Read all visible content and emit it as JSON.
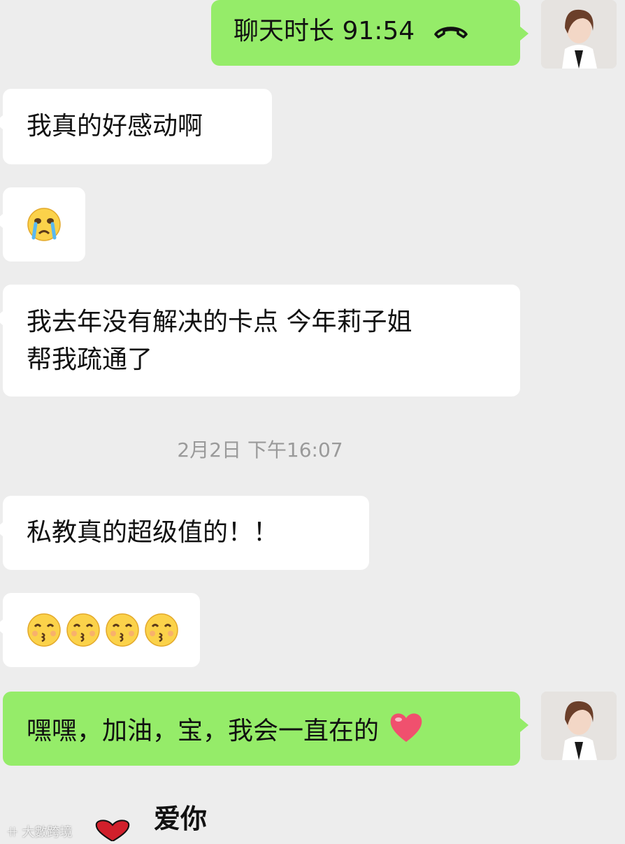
{
  "messages": [
    {
      "side": "out",
      "text": "聊天时长 91:54",
      "icon": "phone-hangup-icon"
    },
    {
      "side": "in",
      "text": "我真的好感动啊"
    },
    {
      "side": "in",
      "emoji": [
        "crying-face"
      ]
    },
    {
      "side": "in",
      "lines": [
        "我去年没有解决的卡点 今年莉子姐",
        "帮我疏通了"
      ]
    },
    {
      "side": "in",
      "text": "私教真的超级值的！！"
    },
    {
      "side": "in",
      "emoji": [
        "kissing-face",
        "kissing-face",
        "kissing-face",
        "kissing-face"
      ]
    },
    {
      "side": "out",
      "text": "嘿嘿，加油，宝，我会一直在的",
      "trailing_emoji": "red-heart"
    }
  ],
  "timestamp": "2月2日 下午16:07",
  "sticker": {
    "text": "爱你",
    "icon": "heart-icon"
  },
  "watermark": "大數跨境",
  "colors": {
    "background": "#ededed",
    "incoming": "#ffffff",
    "outgoing": "#95ec69",
    "timestamp": "#9a9a9a"
  }
}
